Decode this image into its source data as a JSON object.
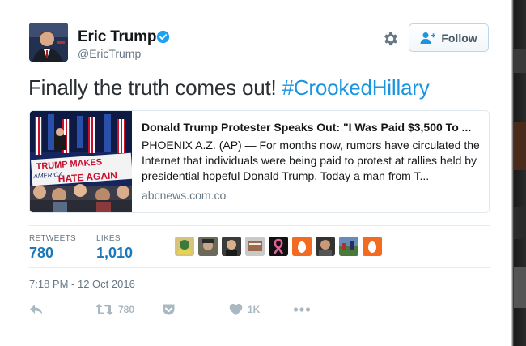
{
  "tweet": {
    "author": {
      "name": "Eric Trump",
      "handle": "@EricTrump",
      "verified": true,
      "avatar_icon": "profile-photo"
    },
    "follow_label": "Follow",
    "text_plain": "Finally the truth comes out! ",
    "hashtag": "#CrookedHillary",
    "card": {
      "title": "Donald Trump Protester Speaks Out: \"I Was Paid $3,500 To ...",
      "description": "PHOENIX A.Z. (AP) — For months now, rumors have circulated the Internet that individuals were being paid to protest at rallies held by presidential hopeful Donald Trump. Today a man from T...",
      "domain": "abcnews.com.co",
      "image_sign_text": [
        "TRUMP MAKES",
        "AMERICA",
        "HATE AGAIN"
      ]
    },
    "stats": {
      "retweets_label": "RETWEETS",
      "retweets": "780",
      "likes_label": "LIKES",
      "likes": "1,010"
    },
    "timestamp": "7:18 PM - 12 Oct 2016",
    "actions": {
      "reply_icon": "reply-icon",
      "retweet_count": "780",
      "like_count": "1K",
      "more_icon": "more-icon"
    },
    "colors": {
      "link": "#1b95e0",
      "stat_value": "#1b77b8",
      "muted": "#657786",
      "action_gray": "#aab8c2"
    }
  }
}
